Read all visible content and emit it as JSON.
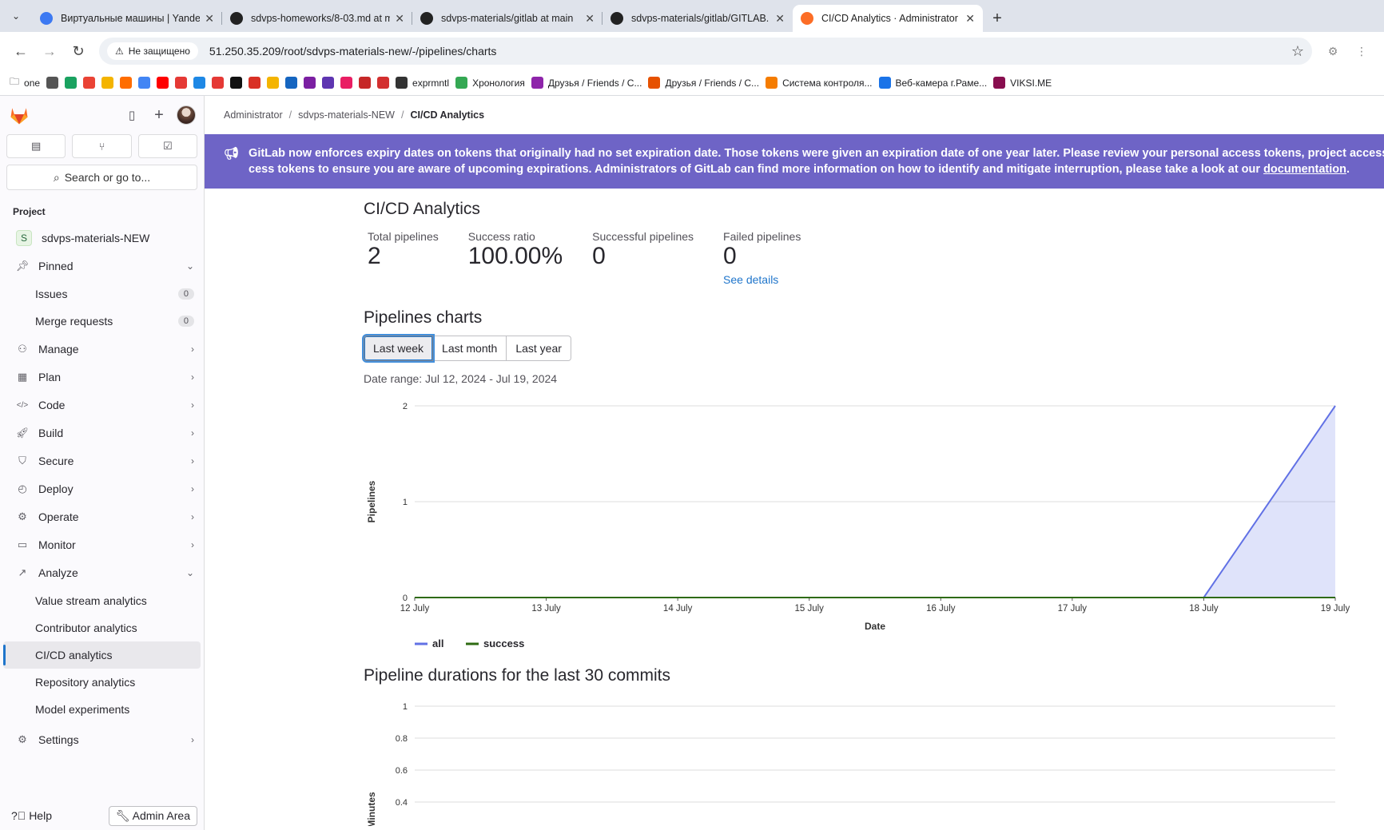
{
  "browser": {
    "tabs": [
      {
        "title": "Виртуальные машины | Yandex",
        "color": "#3c79f2"
      },
      {
        "title": "sdvps-homeworks/8-03.md at m",
        "color": "#222"
      },
      {
        "title": "sdvps-materials/gitlab at main",
        "color": "#222"
      },
      {
        "title": "sdvps-materials/gitlab/GITLAB.",
        "color": "#222"
      },
      {
        "title": "CI/CD Analytics · Administrator",
        "color": "#fc6d26"
      }
    ],
    "security_label": "Не защищено",
    "url": "51.250.35.209/root/sdvps-materials-new/-/pipelines/charts",
    "bookmarks": [
      {
        "label": "one"
      },
      {
        "label": "exprmntl"
      },
      {
        "label": "Хронология"
      },
      {
        "label": "Друзья / Friends / C..."
      },
      {
        "label": "Друзья / Friends / C..."
      },
      {
        "label": "Система контроля..."
      },
      {
        "label": "Веб-камера г.Раме..."
      },
      {
        "label": "VIKSI.ME"
      }
    ]
  },
  "sidebar": {
    "search_label": "Search or go to...",
    "section": "Project",
    "project_name": "sdvps-materials-NEW",
    "project_initial": "S",
    "pinned_label": "Pinned",
    "pinned": [
      {
        "label": "Issues",
        "count": "0"
      },
      {
        "label": "Merge requests",
        "count": "0"
      }
    ],
    "groups": [
      {
        "label": "Manage",
        "icon": "users-icon"
      },
      {
        "label": "Plan",
        "icon": "calendar-icon"
      },
      {
        "label": "Code",
        "icon": "code-icon"
      },
      {
        "label": "Build",
        "icon": "rocket-icon"
      },
      {
        "label": "Secure",
        "icon": "shield-icon"
      },
      {
        "label": "Deploy",
        "icon": "deployments-icon"
      },
      {
        "label": "Operate",
        "icon": "cloud-gear-icon"
      },
      {
        "label": "Monitor",
        "icon": "monitor-icon"
      }
    ],
    "analyze_label": "Analyze",
    "analyze_items": [
      {
        "label": "Value stream analytics"
      },
      {
        "label": "Contributor analytics"
      },
      {
        "label": "CI/CD analytics",
        "active": true
      },
      {
        "label": "Repository analytics"
      },
      {
        "label": "Model experiments"
      }
    ],
    "settings_label": "Settings",
    "help_label": "Help",
    "admin_label": "Admin Area"
  },
  "breadcrumbs": [
    "Administrator",
    "sdvps-materials-NEW",
    "CI/CD Analytics"
  ],
  "banner": {
    "line1": "GitLab now enforces expiry dates on tokens that originally had no set expiration date. Those tokens were given an expiration date of one year later. Please review your personal access tokens, project access tokens, and group ac-",
    "line2_prefix": "cess tokens to ensure you are aware of upcoming expirations. Administrators of GitLab can find more information on how to identify and mitigate interruption, please take a look at our ",
    "line2_link": "documentation",
    "line2_suffix": "."
  },
  "page": {
    "title": "CI/CD Analytics",
    "stats": [
      {
        "label": "Total pipelines",
        "value": "2"
      },
      {
        "label": "Success ratio",
        "value": "100.00%"
      },
      {
        "label": "Successful pipelines",
        "value": "0"
      },
      {
        "label": "Failed pipelines",
        "value": "0",
        "link": "See details"
      }
    ],
    "charts_title": "Pipelines charts",
    "ranges": [
      "Last week",
      "Last month",
      "Last year"
    ],
    "selected_range": "Last week",
    "date_range": "Date range: Jul 12, 2024 - Jul 19, 2024",
    "durations_title": "Pipeline durations for the last 30 commits"
  },
  "chart_data": [
    {
      "type": "area",
      "categories": [
        "12 July",
        "13 July",
        "14 July",
        "15 July",
        "16 July",
        "17 July",
        "18 July",
        "19 July"
      ],
      "series": [
        {
          "name": "all",
          "values": [
            0,
            0,
            0,
            0,
            0,
            0,
            0,
            2
          ],
          "color": "#6171e5"
        },
        {
          "name": "success",
          "values": [
            0,
            0,
            0,
            0,
            0,
            0,
            0,
            0
          ],
          "color": "#2e6b12"
        }
      ],
      "xlabel": "Date",
      "ylabel": "Pipelines",
      "ylim": [
        0,
        2
      ],
      "yticks": [
        "0",
        "1",
        "2"
      ],
      "grid": true,
      "legend": "bottom-left"
    },
    {
      "type": "bar",
      "title": "Pipeline durations for the last 30 commits",
      "ylabel": "Minutes",
      "ylim": [
        0,
        1
      ],
      "yticks": [
        "0.4",
        "0.6",
        "0.8",
        "1"
      ],
      "grid": true
    }
  ]
}
